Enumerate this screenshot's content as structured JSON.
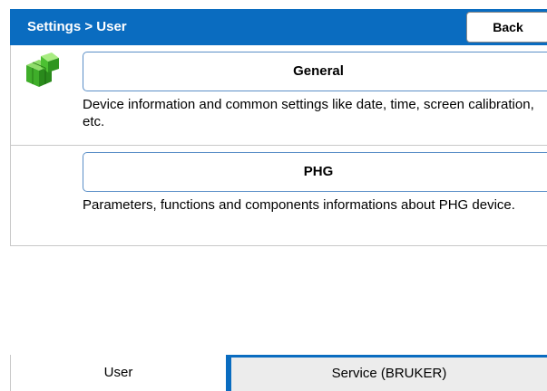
{
  "header": {
    "title": "Settings > User",
    "back_label": "Back"
  },
  "sections": [
    {
      "icon": "green-cube-icon",
      "button_label": "General",
      "description": "Device information and common settings like date, time, screen calibration, etc."
    },
    {
      "button_label": "PHG",
      "description": "Parameters, functions and components informations about PHG device."
    }
  ],
  "tabs": [
    {
      "label": "User",
      "selected": true
    },
    {
      "label": "Service (BRUKER)",
      "selected": false
    }
  ],
  "colors": {
    "header_blue": "#0a6cc0",
    "button_border": "#5b8fc7",
    "cube_green": "#3fae2a"
  }
}
